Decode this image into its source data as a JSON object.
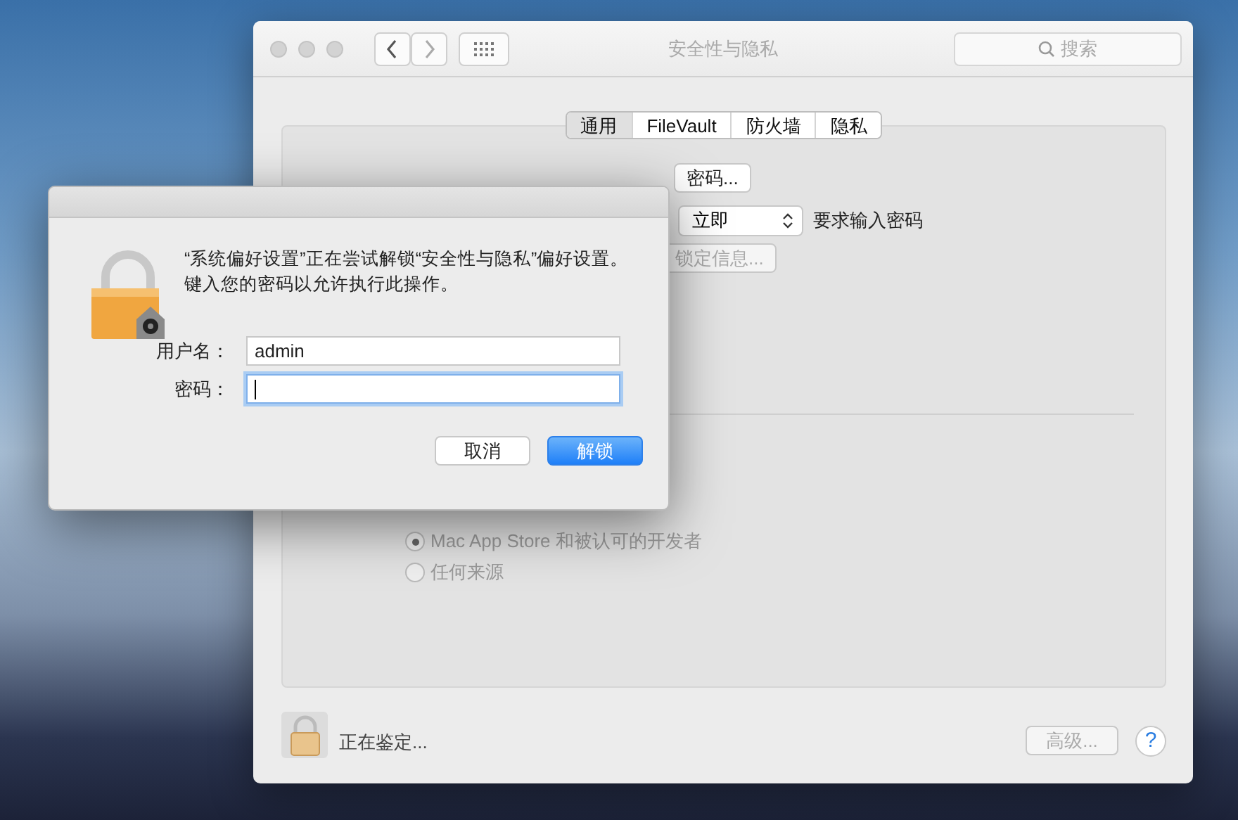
{
  "window": {
    "title": "安全性与隐私",
    "search": {
      "placeholder": "搜索"
    }
  },
  "tabs": [
    {
      "label": "通用",
      "selected": true
    },
    {
      "label": "FileVault",
      "selected": false
    },
    {
      "label": "防火墙",
      "selected": false
    },
    {
      "label": "隐私",
      "selected": false
    }
  ],
  "general": {
    "change_password_button": "密码...",
    "require_password_delay": "立即",
    "require_password_label": "要求输入密码",
    "lock_message_button": "锁定信息..."
  },
  "allow_apps": [
    {
      "label": "Mac App Store 和被认可的开发者",
      "selected": true,
      "disabled": true
    },
    {
      "label": "任何来源",
      "selected": false,
      "disabled": true
    }
  ],
  "footer": {
    "status": "正在鉴定...",
    "advanced_button": {
      "label": "高级...",
      "disabled": true
    },
    "help": "?"
  },
  "dialog": {
    "message": "“系统偏好设置”正在尝试解锁“安全性与隐私”偏好设置。键入您的密码以允许执行此操作。",
    "fields": [
      {
        "label": "用户名：",
        "value": "admin",
        "focused": false
      },
      {
        "label": "密码：",
        "focused": true
      }
    ],
    "buttons": [
      {
        "label": "取消",
        "kind": "default"
      },
      {
        "label": "解锁",
        "kind": "primary"
      }
    ]
  }
}
